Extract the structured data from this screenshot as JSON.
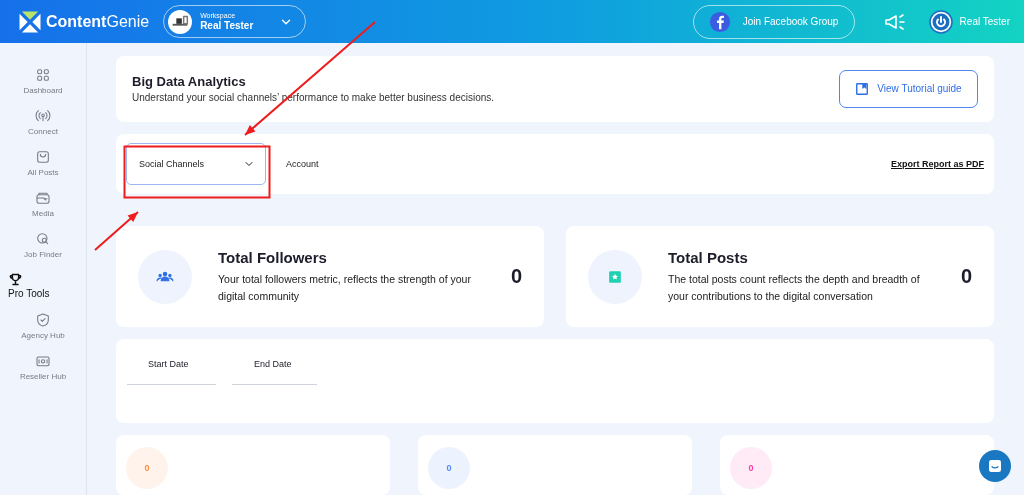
{
  "header": {
    "logo": {
      "brand": "Content",
      "brand_light": "Genie"
    },
    "workspace": {
      "label": "Workspace",
      "name": "Real Tester"
    },
    "facebook_button": "Join Facebook Group",
    "user": "Real Tester"
  },
  "sidebar": {
    "items": [
      {
        "label": "Dashboard",
        "kind": "link"
      },
      {
        "label": "Connect",
        "kind": "link"
      },
      {
        "label": "All Posts",
        "kind": "link"
      },
      {
        "label": "Media",
        "kind": "link"
      },
      {
        "label": "Job Finder",
        "kind": "link"
      },
      {
        "label": "Pro Tools",
        "kind": "section"
      },
      {
        "label": "Agency Hub",
        "kind": "link"
      },
      {
        "label": "Reseller Hub",
        "kind": "link"
      }
    ]
  },
  "intro": {
    "title": "Big Data Analytics",
    "subtitle": "Understand your social channels’ performance to make better business decisions.",
    "tutorial_button": "View Tutorial guide"
  },
  "filters": {
    "select": "Social Channels",
    "tab": "Account",
    "export_link": "Export Report as PDF"
  },
  "stats": [
    {
      "title": "Total Followers",
      "description": "Your total followers metric, reflects the strength of your digital community",
      "value": "0"
    },
    {
      "title": "Total Posts",
      "description": "The total posts count reflects the depth and breadth of your contributions to the digital conversation",
      "value": "0"
    }
  ],
  "dates": [
    {
      "label": "Start Date"
    },
    {
      "label": "End Date"
    }
  ],
  "counters": [
    {
      "value": "0",
      "color": "#ff8a3d"
    },
    {
      "value": "0",
      "color": "#4d8cf5"
    },
    {
      "value": "0",
      "color": "#f23fa5"
    }
  ],
  "annotations": [
    {
      "kind": "arrow"
    },
    {
      "kind": "arrow"
    },
    {
      "kind": "highlight"
    }
  ]
}
